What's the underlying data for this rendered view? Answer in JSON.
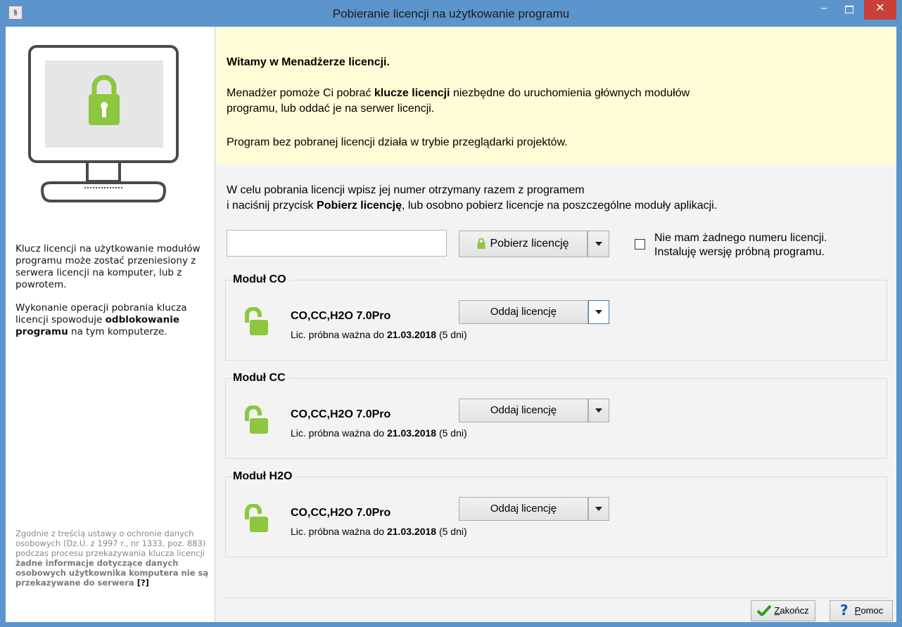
{
  "window": {
    "app_icon": "§",
    "title": "Pobieranie licencji na użytkowanie programu",
    "minimize": "–",
    "close": "✕"
  },
  "sidebar": {
    "para1": "Klucz licencji na użytkowanie modułów programu może zostać przeniesiony z serwera licencji na komputer, lub z powrotem.",
    "para2_start": "Wykonanie operacji pobrania klucza licencji spowoduje ",
    "para2_bold": "odblokowanie programu",
    "para2_end": " na tym komputerze.",
    "legal_start": "Zgodnie z treścią ustawy o ochronie danych osobowych (Dz.U. z 1997 r., nr 1333, poz. 883) podczas procesu przekazywania klucza licencji ",
    "legal_bold": "żadne informacje dotyczące danych osobowych użytkownika komputera nie są przekazywane do serwera",
    "legal_help": "[?]"
  },
  "banner": {
    "title": "Witamy w Menadżerze licencji.",
    "p1_start": "Menadżer pomoże Ci pobrać ",
    "p1_bold": "klucze licencji",
    "p1_end": " niezbędne do uruchomienia głównych modułów programu, lub oddać je na serwer licencji.",
    "p2": "Program bez pobranej licencji działa w trybie przeglądarki projektów."
  },
  "instructions": {
    "line1": "W celu pobrania licencji wpisz jej numer otrzymany razem z programem",
    "line2_start": "i naciśnij przycisk ",
    "line2_bold": "Pobierz licencję",
    "line2_end": ", lub osobno pobierz licencje na poszczególne moduły aplikacji."
  },
  "license_input": {
    "value": "",
    "placeholder": ""
  },
  "pobierz_button": {
    "label": "Pobierz licencję"
  },
  "trial": {
    "checked": false,
    "line1": "Nie mam żadnego numeru licencji.",
    "line2": "Instaluję wersję próbną programu."
  },
  "modules": [
    {
      "title": "Moduł CO",
      "name": "CO,CC,H2O 7.0Pro",
      "exp_prefix": "Lic. próbna ważna do ",
      "exp_date": "21.03.2018",
      "exp_days": " (5 dni)",
      "button": "Oddaj licencję"
    },
    {
      "title": "Moduł CC",
      "name": "CO,CC,H2O 7.0Pro",
      "exp_prefix": "Lic. próbna ważna do ",
      "exp_date": "21.03.2018",
      "exp_days": " (5 dni)",
      "button": "Oddaj licencję"
    },
    {
      "title": "Moduł H2O",
      "name": "CO,CC,H2O 7.0Pro",
      "exp_prefix": "Lic. próbna ważna do ",
      "exp_date": "21.03.2018",
      "exp_days": " (5 dni)",
      "button": "Oddaj licencję"
    }
  ],
  "footer": {
    "finish_first": "Z",
    "finish_rest": "akończ",
    "help_first": "P",
    "help_rest": "omoc"
  },
  "colors": {
    "lock_green": "#8dc63f",
    "banner_bg": "#fffcd7",
    "title_bar": "#5b95cc",
    "close_red": "#c9403a"
  },
  "icons": [
    "padlock-closed-icon",
    "padlock-open-icon",
    "checkmark-icon",
    "question-icon"
  ]
}
